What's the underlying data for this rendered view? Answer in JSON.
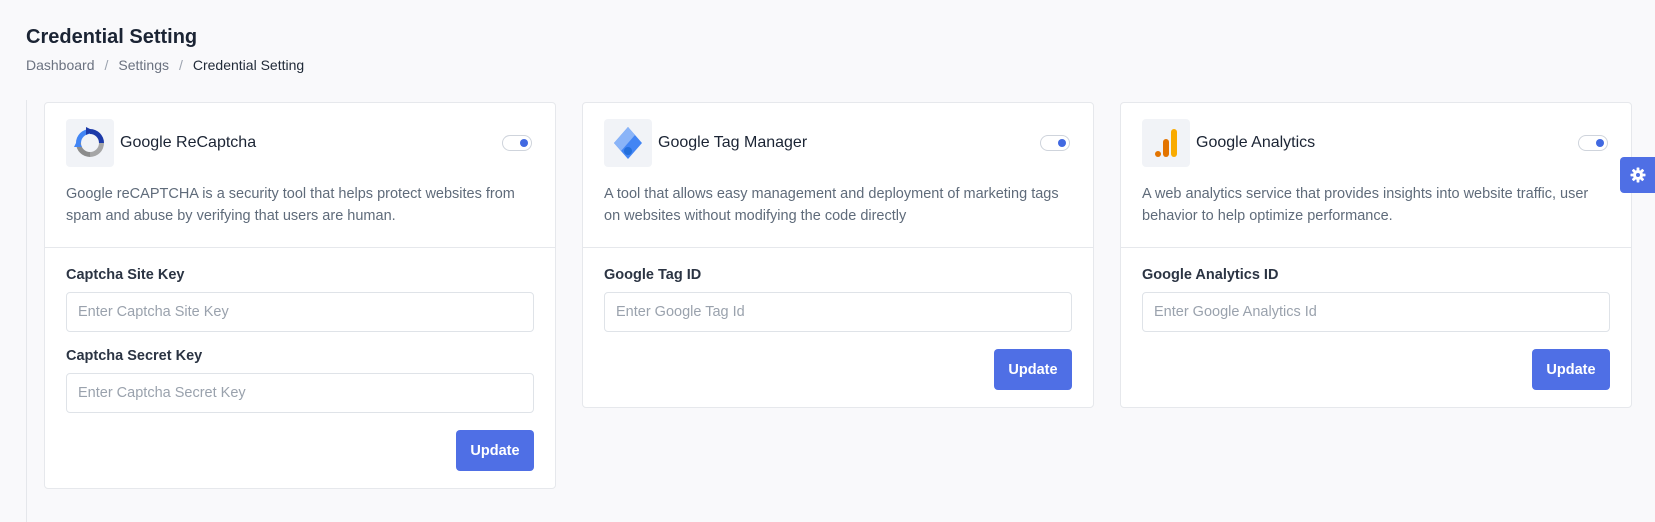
{
  "page": {
    "title": "Credential Setting",
    "breadcrumb": [
      "Dashboard",
      "Settings",
      "Credential Setting"
    ]
  },
  "colors": {
    "accent": "#4f6fe5",
    "toggle_on": "#4169e1"
  },
  "cards": [
    {
      "name": "Google ReCaptcha",
      "icon": "recaptcha-icon",
      "enabled": true,
      "description": "Google reCAPTCHA is a security tool that helps protect websites from spam and abuse by verifying that users are human.",
      "fields": [
        {
          "label": "Captcha Site Key",
          "value": "",
          "placeholder": "Enter Captcha Site Key"
        },
        {
          "label": "Captcha Secret Key",
          "value": "",
          "placeholder": "Enter Captcha Secret Key"
        }
      ],
      "button_label": "Update"
    },
    {
      "name": "Google Tag Manager",
      "icon": "tag-manager-icon",
      "enabled": true,
      "description": "A tool that allows easy management and deployment of marketing tags on websites without modifying the code directly",
      "fields": [
        {
          "label": "Google Tag ID",
          "value": "",
          "placeholder": "Enter Google Tag Id"
        }
      ],
      "button_label": "Update"
    },
    {
      "name": "Google Analytics",
      "icon": "analytics-icon",
      "enabled": true,
      "description": "A web analytics service that provides insights into website traffic, user behavior to help optimize performance.",
      "fields": [
        {
          "label": "Google Analytics ID",
          "value": "",
          "placeholder": "Enter Google Analytics Id"
        }
      ],
      "button_label": "Update"
    }
  ],
  "settings_tab": {
    "icon": "gear-icon"
  }
}
